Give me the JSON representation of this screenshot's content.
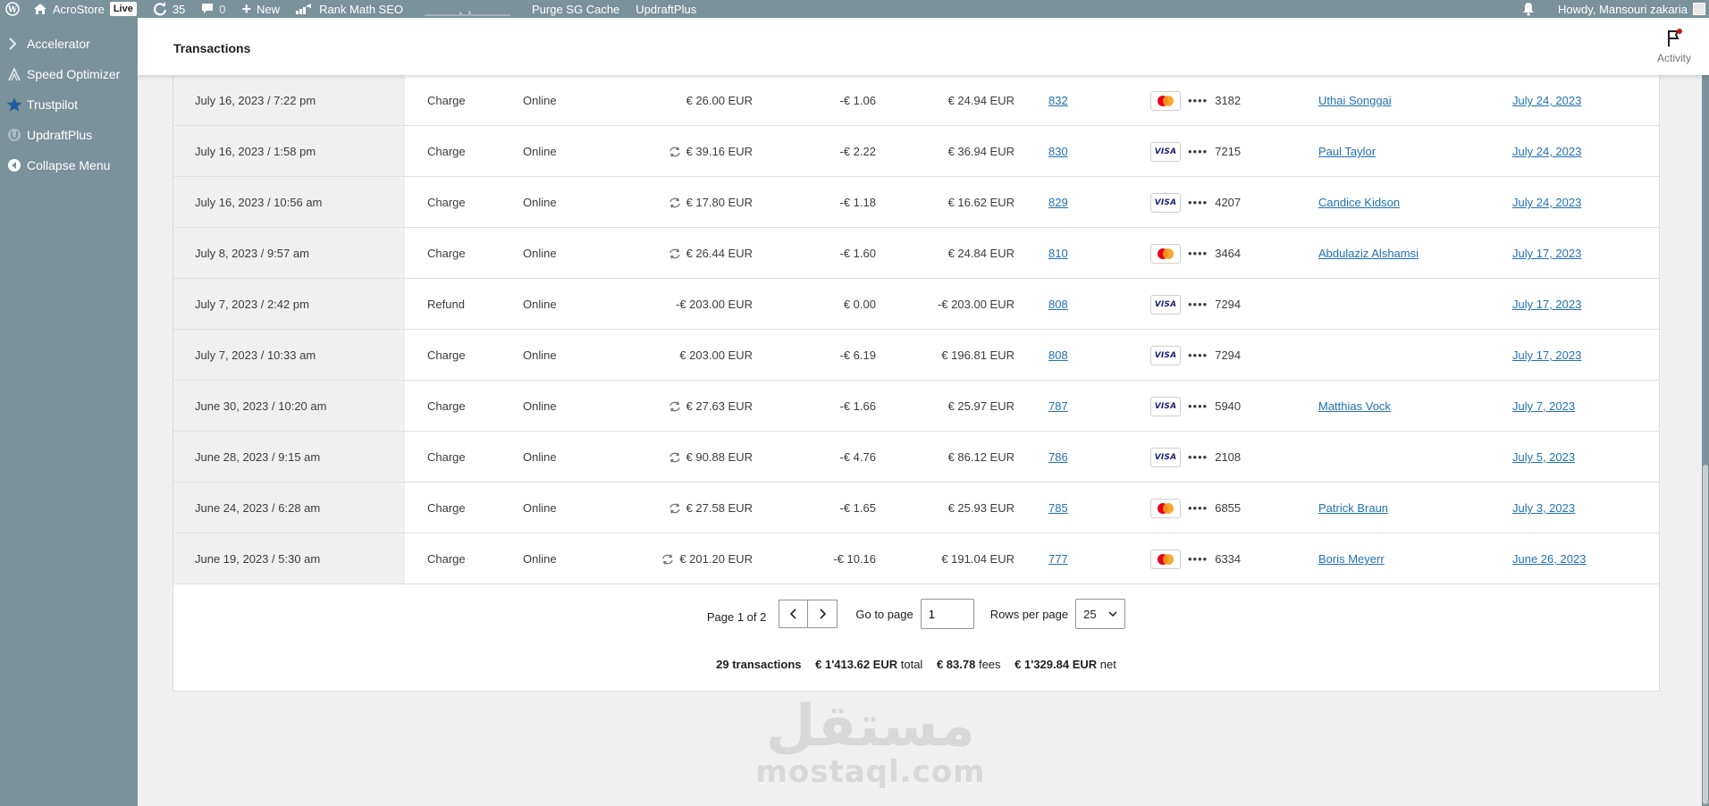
{
  "adminbar": {
    "site_name": "AcroStore",
    "live_badge": "Live",
    "updates_count": "35",
    "comments_count": "0",
    "new_label": "New",
    "rankmath_label": "Rank Math SEO",
    "purge_label": "Purge SG Cache",
    "updraft_label": "UpdraftPlus",
    "greeting": "Howdy, Mansouri zakaria"
  },
  "sidebar": {
    "items": [
      {
        "label": "Accelerator",
        "icon": "accelerator-icon"
      },
      {
        "label": "Speed Optimizer",
        "icon": "speed-optimizer-icon"
      },
      {
        "label": "Trustpilot",
        "icon": "star-icon"
      },
      {
        "label": "UpdraftPlus",
        "icon": "updraft-icon"
      },
      {
        "label": "Collapse Menu",
        "icon": "collapse-icon"
      }
    ]
  },
  "header": {
    "title": "Transactions",
    "activity_label": "Activity"
  },
  "transactions": [
    {
      "date": "July 16, 2023 / 7:22 pm",
      "type": "Charge",
      "channel": "Online",
      "amount": "€ 26.00 EUR",
      "converted": false,
      "fees": "-€ 1.06",
      "net": "€ 24.94 EUR",
      "order": "832",
      "brand": "mastercard",
      "last4": "3182",
      "customer": "Uthai Songgai",
      "deposit": "July 24, 2023"
    },
    {
      "date": "July 16, 2023 / 1:58 pm",
      "type": "Charge",
      "channel": "Online",
      "amount": "€ 39.16 EUR",
      "converted": true,
      "fees": "-€ 2.22",
      "net": "€ 36.94 EUR",
      "order": "830",
      "brand": "visa",
      "last4": "7215",
      "customer": "Paul Taylor",
      "deposit": "July 24, 2023"
    },
    {
      "date": "July 16, 2023 / 10:56 am",
      "type": "Charge",
      "channel": "Online",
      "amount": "€ 17.80 EUR",
      "converted": true,
      "fees": "-€ 1.18",
      "net": "€ 16.62 EUR",
      "order": "829",
      "brand": "visa",
      "last4": "4207",
      "customer": "Candice Kidson",
      "deposit": "July 24, 2023"
    },
    {
      "date": "July 8, 2023 / 9:57 am",
      "type": "Charge",
      "channel": "Online",
      "amount": "€ 26.44 EUR",
      "converted": true,
      "fees": "-€ 1.60",
      "net": "€ 24.84 EUR",
      "order": "810",
      "brand": "mastercard",
      "last4": "3464",
      "customer": "Abdulaziz Alshamsi",
      "deposit": "July 17, 2023"
    },
    {
      "date": "July 7, 2023 / 2:42 pm",
      "type": "Refund",
      "channel": "Online",
      "amount": "-€ 203.00 EUR",
      "converted": false,
      "fees": "€ 0.00",
      "net": "-€ 203.00 EUR",
      "order": "808",
      "brand": "visa",
      "last4": "7294",
      "customer": "",
      "deposit": "July 17, 2023"
    },
    {
      "date": "July 7, 2023 / 10:33 am",
      "type": "Charge",
      "channel": "Online",
      "amount": "€ 203.00 EUR",
      "converted": false,
      "fees": "-€ 6.19",
      "net": "€ 196.81 EUR",
      "order": "808",
      "brand": "visa",
      "last4": "7294",
      "customer": "",
      "deposit": "July 17, 2023"
    },
    {
      "date": "June 30, 2023 / 10:20 am",
      "type": "Charge",
      "channel": "Online",
      "amount": "€ 27.63 EUR",
      "converted": true,
      "fees": "-€ 1.66",
      "net": "€ 25.97 EUR",
      "order": "787",
      "brand": "visa",
      "last4": "5940",
      "customer": "Matthias Vock",
      "deposit": "July 7, 2023"
    },
    {
      "date": "June 28, 2023 / 9:15 am",
      "type": "Charge",
      "channel": "Online",
      "amount": "€ 90.88 EUR",
      "converted": true,
      "fees": "-€ 4.76",
      "net": "€ 86.12 EUR",
      "order": "786",
      "brand": "visa",
      "last4": "2108",
      "customer": "",
      "deposit": "July 5, 2023"
    },
    {
      "date": "June 24, 2023 / 6:28 am",
      "type": "Charge",
      "channel": "Online",
      "amount": "€ 27.58 EUR",
      "converted": true,
      "fees": "-€ 1.65",
      "net": "€ 25.93 EUR",
      "order": "785",
      "brand": "mastercard",
      "last4": "6855",
      "customer": "Patrick Braun",
      "deposit": "July 3, 2023"
    },
    {
      "date": "June 19, 2023 / 5:30 am",
      "type": "Charge",
      "channel": "Online",
      "amount": "€ 201.20 EUR",
      "converted": true,
      "fees": "-€ 10.16",
      "net": "€ 191.04 EUR",
      "order": "777",
      "brand": "mastercard",
      "last4": "6334",
      "customer": "Boris Meyerr",
      "deposit": "June 26, 2023"
    }
  ],
  "card_dots": "••••",
  "visa_label": "VISA",
  "pagination": {
    "page_info": "Page 1 of 2",
    "goto_label": "Go to page",
    "goto_value": "1",
    "rows_label": "Rows per page",
    "rows_value": "25"
  },
  "summary": {
    "count": "29 transactions",
    "total_amount": "€ 1'413.62 EUR",
    "total_label": "total",
    "fees_amount": "€ 83.78",
    "fees_label": "fees",
    "net_amount": "€ 1'329.84 EUR",
    "net_label": "net"
  },
  "watermark": {
    "arabic": "مستقل",
    "latin": "mostaql.com"
  },
  "colors": {
    "admin_bg": "#7a929a",
    "link": "#2271b1",
    "content_bg": "#f0f0f1"
  }
}
